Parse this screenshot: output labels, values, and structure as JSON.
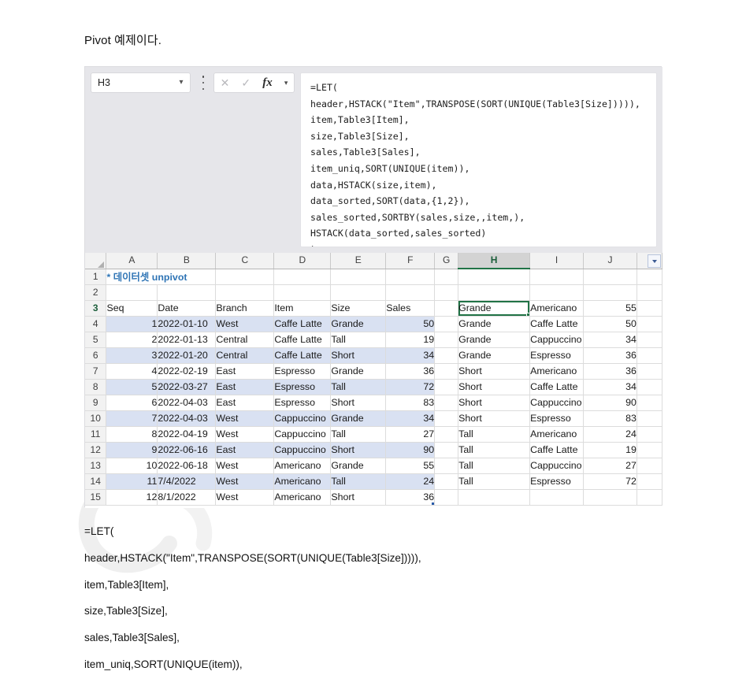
{
  "caption": "Pivot 예제이다.",
  "formula_bar": {
    "name_box_value": "H3",
    "name_box_chevron": "chevron-down-icon",
    "cancel_icon": "✕",
    "confirm_icon": "✓",
    "fx_icon": "fx",
    "fx_chevron": "⌵",
    "formula_text": "=LET(\nheader,HSTACK(\"Item\",TRANSPOSE(SORT(UNIQUE(Table3[Size])))),\nitem,Table3[Item],\nsize,Table3[Size],\nsales,Table3[Sales],\nitem_uniq,SORT(UNIQUE(item)),\ndata,HSTACK(size,item),\ndata_sorted,SORT(data,{1,2}),\nsales_sorted,SORTBY(sales,size,,item,),\nHSTACK(data_sorted,sales_sorted)\n)"
  },
  "sheet": {
    "column_letters": [
      "A",
      "B",
      "C",
      "D",
      "E",
      "F",
      "G",
      "H",
      "I",
      "J"
    ],
    "selected_column": "H",
    "row_numbers": [
      "1",
      "2",
      "3",
      "4",
      "5",
      "6",
      "7",
      "8",
      "9",
      "10",
      "11",
      "12",
      "13",
      "14",
      "15"
    ],
    "selected_row": "3",
    "a1_title_prefix": "* 데이터셋",
    "a1_title_suffix": "unpivot",
    "a1_color": "#2e74b5",
    "table_header_color": "#4472c4",
    "band_color": "#d9e1f2",
    "selection_color": "#217346",
    "spill_border_color": "#7ba0d8"
  },
  "source_table": {
    "headers": [
      "Seq",
      "Date",
      "Branch",
      "Item",
      "Size",
      "Sales"
    ],
    "rows": [
      [
        "1",
        "2022-01-10",
        "West",
        "Caffe Latte",
        "Grande",
        "50"
      ],
      [
        "2",
        "2022-01-13",
        "Central",
        "Caffe Latte",
        "Tall",
        "19"
      ],
      [
        "3",
        "2022-01-20",
        "Central",
        "Caffe Latte",
        "Short",
        "34"
      ],
      [
        "4",
        "2022-02-19",
        "East",
        "Espresso",
        "Grande",
        "36"
      ],
      [
        "5",
        "2022-03-27",
        "East",
        "Espresso",
        "Tall",
        "72"
      ],
      [
        "6",
        "2022-04-03",
        "East",
        "Espresso",
        "Short",
        "83"
      ],
      [
        "7",
        "2022-04-03",
        "West",
        "Cappuccino",
        "Grande",
        "34"
      ],
      [
        "8",
        "2022-04-19",
        "West",
        "Cappuccino",
        "Tall",
        "27"
      ],
      [
        "9",
        "2022-06-16",
        "East",
        "Cappuccino",
        "Short",
        "90"
      ],
      [
        "10",
        "2022-06-18",
        "West",
        "Americano",
        "Grande",
        "55"
      ],
      [
        "11",
        "7/4/2022",
        "West",
        "Americano",
        "Tall",
        "24"
      ],
      [
        "12",
        "8/1/2022",
        "West",
        "Americano",
        "Short",
        "36"
      ]
    ]
  },
  "result_table": {
    "rows": [
      [
        "Grande",
        "Americano",
        "55"
      ],
      [
        "Grande",
        "Caffe Latte",
        "50"
      ],
      [
        "Grande",
        "Cappuccino",
        "34"
      ],
      [
        "Grande",
        "Espresso",
        "36"
      ],
      [
        "Short",
        "Americano",
        "36"
      ],
      [
        "Short",
        "Caffe Latte",
        "34"
      ],
      [
        "Short",
        "Cappuccino",
        "90"
      ],
      [
        "Short",
        "Espresso",
        "83"
      ],
      [
        "Tall",
        "Americano",
        "24"
      ],
      [
        "Tall",
        "Caffe Latte",
        "19"
      ],
      [
        "Tall",
        "Cappuccino",
        "27"
      ],
      [
        "Tall",
        "Espresso",
        "72"
      ]
    ]
  },
  "code_lines": [
    "=LET(",
    "header,HSTACK(\"Item\",TRANSPOSE(SORT(UNIQUE(Table3[Size])))),",
    "item,Table3[Item],",
    "size,Table3[Size],",
    "sales,Table3[Sales],",
    "item_uniq,SORT(UNIQUE(item)),"
  ]
}
